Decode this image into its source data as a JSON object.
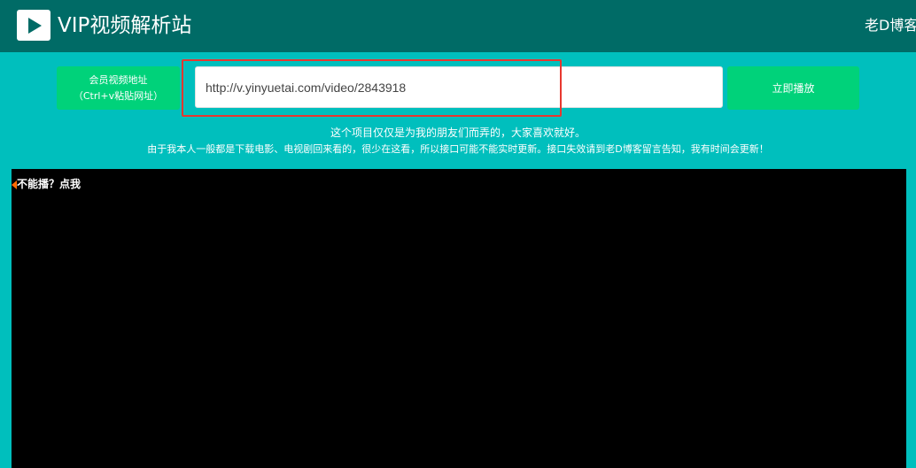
{
  "header": {
    "logo_icon": "play-icon",
    "site_title": "VIP视频解析站",
    "blog_link": "老D博客",
    "background_color": "#006b66"
  },
  "search": {
    "label_line1": "会员视频地址",
    "label_line2": "（Ctrl+v粘贴网址）",
    "url_value": "http://v.yinyuetai.com/video/2843918",
    "play_button_label": "立即播放",
    "accent_color": "#00d27a"
  },
  "notices": {
    "line1": "这个项目仅仅是为我的朋友们而弄的，大家喜欢就好。",
    "line2": "由于我本人一般都是下载电影、电视剧回来看的，很少在这看，所以接口可能不能实时更新。接口失效请到老D博客留言告知，我有时间会更新！"
  },
  "player": {
    "cant_play_link": "不能播？点我",
    "marker_color": "#ff6a00"
  },
  "annotation": {
    "highlight_color": "#e8372f"
  },
  "page_background": "#00bfbd"
}
